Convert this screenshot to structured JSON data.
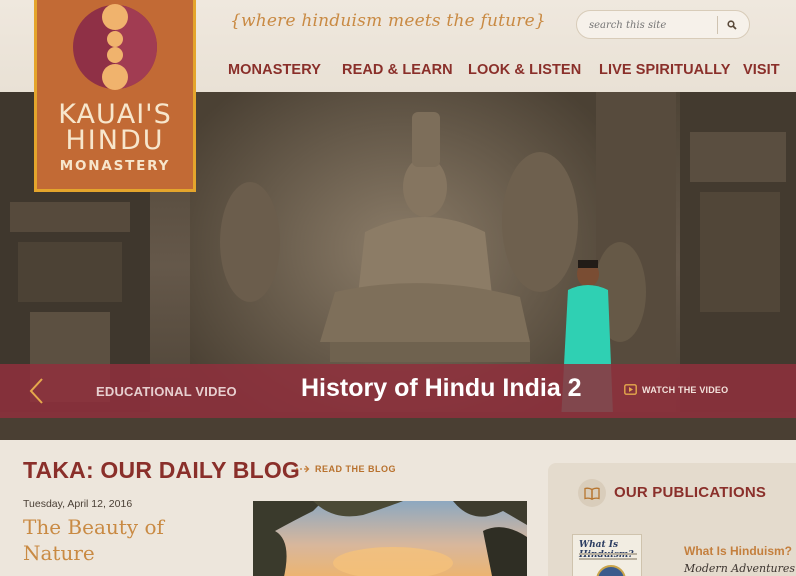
{
  "header": {
    "tagline": "{where hinduism meets the future}",
    "search_placeholder": "search this site"
  },
  "logo": {
    "line1": "KAUAI'S",
    "line2": "HINDU",
    "line3": "MONASTERY"
  },
  "nav": {
    "items": [
      "MONASTERY",
      "READ & LEARN",
      "LOOK & LISTEN",
      "LIVE SPIRITUALLY",
      "VISIT"
    ]
  },
  "hero": {
    "label": "EDUCATIONAL VIDEO",
    "title": "History of Hindu India 2",
    "cta": "WATCH THE VIDEO"
  },
  "blog": {
    "title": "TAKA: OUR DAILY BLOG",
    "link": "READ THE BLOG",
    "post_date": "Tuesday, April 12, 2016",
    "post_title": "The Beauty of Nature"
  },
  "publications": {
    "title": "OUR PUBLICATIONS",
    "book_cover_title": "What Is Hinduism?",
    "book_name": "What Is Hinduism?",
    "book_subtitle": "Modern Adventures int"
  },
  "colors": {
    "maroon": "#8a2f2a",
    "gold": "#c98a43",
    "logo_orange": "#c26a35",
    "hero_bar": "#8f303c"
  },
  "icons": [
    "search-icon",
    "chevron-left-icon",
    "video-icon",
    "arrow-right-icon",
    "book-icon"
  ]
}
